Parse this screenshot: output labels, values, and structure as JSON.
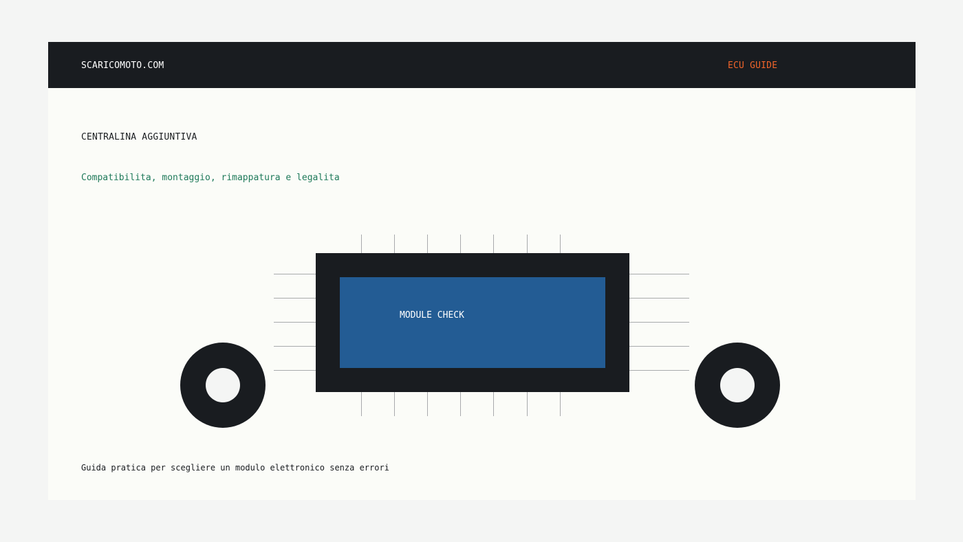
{
  "header": {
    "brand": "SCARICOMOTO.COM",
    "nav_link": "ECU GUIDE"
  },
  "hero": {
    "eyebrow": "CENTRALINA AGGIUNTIVA",
    "subtitle": "Compatibilita, montaggio, rimappatura e legalita",
    "caption": "Guida pratica per scegliere un modulo elettronico senza errori"
  },
  "illustration": {
    "screen_label": "MODULE CHECK",
    "icon": "ecu-module-illustration"
  },
  "colors": {
    "page_background": "#f4f5f4",
    "card_background": "#fbfcf8",
    "header_background": "#191c20",
    "accent": "#f0642a",
    "subtitle": "#1f7a5a",
    "screen": "#235c94",
    "pin": "#a8aaac"
  }
}
